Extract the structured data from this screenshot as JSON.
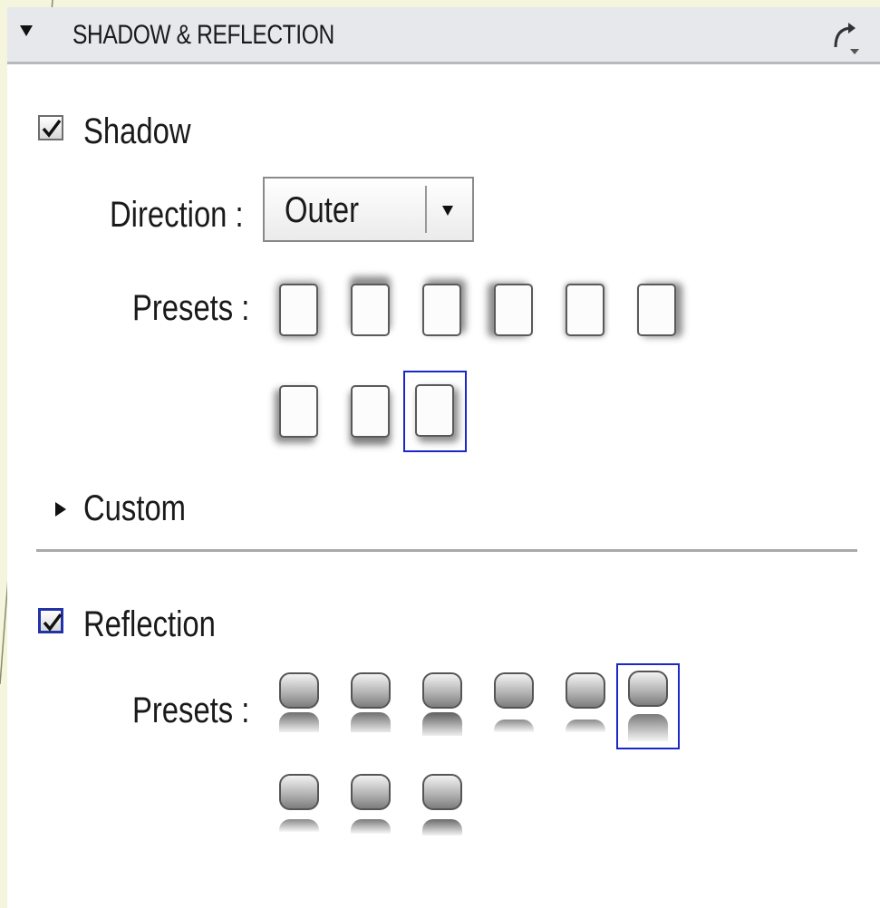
{
  "header": {
    "title": "SHADOW & REFLECTION",
    "collapse_icon": "triangle-down-icon",
    "reset_icon": "reset-arrow-icon"
  },
  "shadow": {
    "label": "Shadow",
    "checked": true,
    "direction_label": "Direction :",
    "direction_value": "Outer",
    "presets_label": "Presets :",
    "preset_count": 9,
    "selected_preset": 9,
    "custom_label": "Custom"
  },
  "reflection": {
    "label": "Reflection",
    "checked": true,
    "presets_label": "Presets :",
    "preset_count": 9,
    "selected_preset": 6
  },
  "colors": {
    "selection_border": "#1b27c9",
    "header_background": "#e6e8ec",
    "page_background": "#f4f5dc"
  }
}
